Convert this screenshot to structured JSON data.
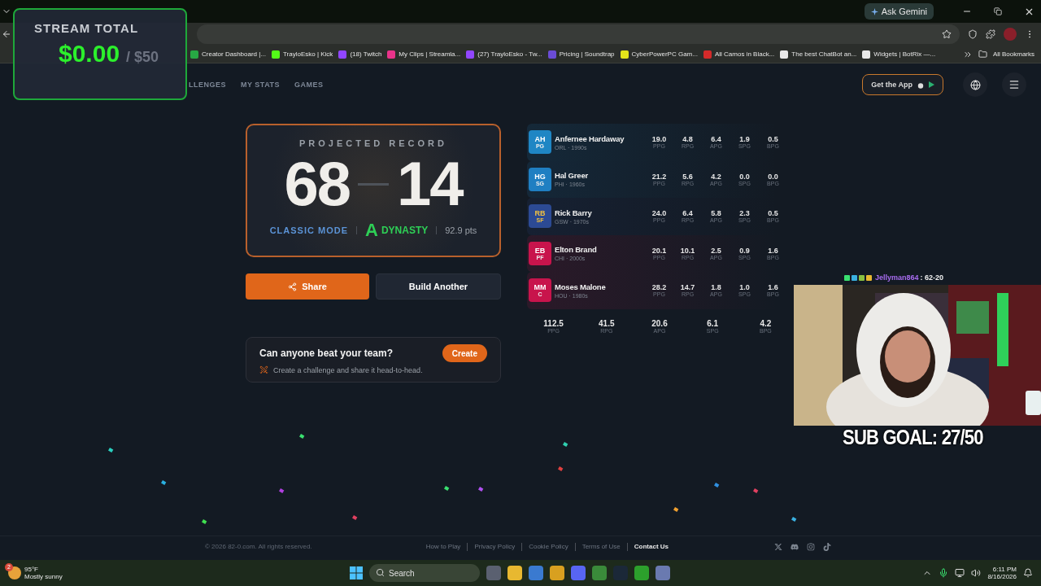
{
  "browser": {
    "ask_button": "Ask Gemini",
    "all_bookmarks": "All Bookmarks",
    "bookmarks": [
      {
        "label": "Creator Dashboard |...",
        "color": "#27a844"
      },
      {
        "label": "TrayloEsko | Kick",
        "color": "#53fc18"
      },
      {
        "label": "(18) Twitch",
        "color": "#9146ff"
      },
      {
        "label": "My Clips | Streamla...",
        "color": "#e8338a"
      },
      {
        "label": "(27) TrayloEsko - Tw...",
        "color": "#9146ff"
      },
      {
        "label": "Pricing | Soundtrap",
        "color": "#6b4cd6"
      },
      {
        "label": "CyberPowerPC Gam...",
        "color": "#e4e41a"
      },
      {
        "label": "All Camos in Black...",
        "color": "#d42a2a"
      },
      {
        "label": "The best ChatBot an...",
        "color": "#e8e8e8"
      },
      {
        "label": "Widgets | BotRix —...",
        "color": "#e8e8e8"
      }
    ]
  },
  "nav": {
    "items": [
      {
        "label": "LLENGES"
      },
      {
        "label": "MY STATS"
      },
      {
        "label": "GAMES"
      }
    ],
    "get_app": "Get the App"
  },
  "record": {
    "heading": "PROJECTED RECORD",
    "wins": "68",
    "losses": "14",
    "mode": "CLASSIC MODE",
    "grade": "A",
    "tier": "DYNASTY",
    "points": "92.9 pts"
  },
  "actions": [
    {
      "label": "Share",
      "kind": "primary"
    },
    {
      "label": "Build Another",
      "kind": "secondary"
    }
  ],
  "challenge": {
    "title": "Can anyone beat your team?",
    "button": "Create",
    "text": "Create a challenge and share it head-to-head."
  },
  "players": [
    {
      "initials": "AH",
      "position": "PG",
      "name": "Anfernee Hardaway",
      "team_era": "ORL · 1990s",
      "color": "#1f86c4",
      "stats": [
        {
          "value": "19.0",
          "label": "PPG"
        },
        {
          "value": "4.8",
          "label": "RPG"
        },
        {
          "value": "6.4",
          "label": "APG"
        },
        {
          "value": "1.9",
          "label": "SPG"
        },
        {
          "value": "0.5",
          "label": "BPG"
        }
      ]
    },
    {
      "initials": "HG",
      "position": "SG",
      "name": "Hal Greer",
      "team_era": "PHI · 1960s",
      "color": "#1f7fc2",
      "stats": [
        {
          "value": "21.2",
          "label": "PPG"
        },
        {
          "value": "5.6",
          "label": "RPG"
        },
        {
          "value": "4.2",
          "label": "APG"
        },
        {
          "value": "0.0",
          "label": "SPG"
        },
        {
          "value": "0.0",
          "label": "BPG"
        }
      ]
    },
    {
      "initials": "RB",
      "position": "SF",
      "name": "Rick Barry",
      "team_era": "GSW · 1970s",
      "color": "#2c4a94",
      "stats": [
        {
          "value": "24.0",
          "label": "PPG"
        },
        {
          "value": "6.4",
          "label": "RPG"
        },
        {
          "value": "5.8",
          "label": "APG"
        },
        {
          "value": "2.3",
          "label": "SPG"
        },
        {
          "value": "0.5",
          "label": "BPG"
        }
      ]
    },
    {
      "initials": "EB",
      "position": "PF",
      "name": "Elton Brand",
      "team_era": "CHI · 2000s",
      "color": "#c8144c",
      "stats": [
        {
          "value": "20.1",
          "label": "PPG"
        },
        {
          "value": "10.1",
          "label": "RPG"
        },
        {
          "value": "2.5",
          "label": "APG"
        },
        {
          "value": "0.9",
          "label": "SPG"
        },
        {
          "value": "1.6",
          "label": "BPG"
        }
      ]
    },
    {
      "initials": "MM",
      "position": "C",
      "name": "Moses Malone",
      "team_era": "HOU · 1980s",
      "color": "#c8144c",
      "stats": [
        {
          "value": "28.2",
          "label": "PPG"
        },
        {
          "value": "14.7",
          "label": "RPG"
        },
        {
          "value": "1.8",
          "label": "APG"
        },
        {
          "value": "1.0",
          "label": "SPG"
        },
        {
          "value": "1.6",
          "label": "BPG"
        }
      ]
    }
  ],
  "totals": [
    {
      "value": "112.5",
      "label": "PPG"
    },
    {
      "value": "41.5",
      "label": "RPG"
    },
    {
      "value": "20.6",
      "label": "APG"
    },
    {
      "value": "6.1",
      "label": "SPG"
    },
    {
      "value": "4.2",
      "label": "BPG"
    }
  ],
  "footer": {
    "copyright": "© 2026 82-0.com. All rights reserved.",
    "links": [
      {
        "label": "How to Play"
      },
      {
        "label": "Privacy Policy"
      },
      {
        "label": "Cookie Policy"
      },
      {
        "label": "Terms of Use"
      },
      {
        "label": "Contact Us"
      }
    ]
  },
  "stream": {
    "total_label": "STREAM TOTAL",
    "amount": "$0.00",
    "goal": "/ $50",
    "chat_user": "Jellyman864",
    "chat_message": ": 62-20",
    "sub_goal": "SUB GOAL: 27/50"
  },
  "taskbar": {
    "weather_badge": "2",
    "temperature": "95°F",
    "weather": "Mostly sunny",
    "search_placeholder": "Search",
    "time": "6:11 PM",
    "date": "8/16/2026"
  }
}
